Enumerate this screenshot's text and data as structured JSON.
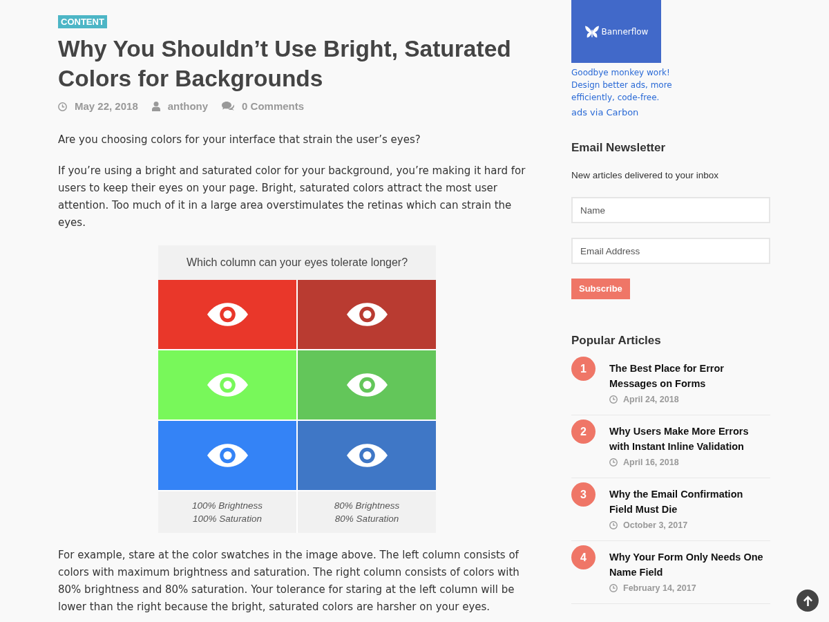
{
  "article": {
    "category": "CONTENT",
    "title": "Why You Shouldn’t Use Bright, Saturated Colors for Backgrounds",
    "meta": [
      {
        "kind": "date",
        "text": "May 22, 2018"
      },
      {
        "kind": "author",
        "text": "anthony"
      },
      {
        "kind": "comments",
        "text": "0 Comments"
      }
    ],
    "body": [
      {
        "kind": "paragraph",
        "text": "Are you choosing colors for your interface that strain the user’s eyes?"
      },
      {
        "kind": "paragraph",
        "text": "If you’re using a bright and saturated color for your background, you’re making it hard for users to keep their eyes on your page. Bright, saturated colors attract the most user attention. Too much of it in a large area overstimulates the retinas which can strain the eyes."
      },
      {
        "kind": "figure",
        "title": "Which column can your eyes tolerate longer?",
        "columns": [
          {
            "swatches": [
              {
                "color": "#e9372a"
              },
              {
                "color": "#78f85a"
              },
              {
                "color": "#3483f6"
              }
            ],
            "caption": [
              "100% Brightness",
              "100% Saturation"
            ]
          },
          {
            "swatches": [
              {
                "color": "#b93b31"
              },
              {
                "color": "#63c65a"
              },
              {
                "color": "#3f77c6"
              }
            ],
            "caption": [
              "80% Brightness",
              "80% Saturation"
            ]
          }
        ]
      },
      {
        "kind": "paragraph",
        "text": "For example, stare at the color swatches in the image above. The left column consists of colors with maximum brightness and saturation. The right column consists of colors with 80% brightness and 80% saturation. Your tolerance for staring at the left column will be lower than the right because the bright, saturated colors are harsher on your eyes."
      }
    ]
  },
  "sidebar": {
    "ad": {
      "brand": "Bannerflow",
      "text": "Goodbye monkey work! Design better ads, more efficiently, code-free.",
      "via": "ads via Carbon"
    },
    "newsletter": {
      "title": "Email Newsletter",
      "description": "New articles delivered to your inbox",
      "fields": [
        {
          "placeholder": "Name"
        },
        {
          "placeholder": "Email Address"
        }
      ],
      "button": "Subscribe"
    },
    "popular": {
      "title": "Popular Articles",
      "items": [
        {
          "number": "1",
          "title": "The Best Place for Error Messages on Forms",
          "date": "April 24, 2018"
        },
        {
          "number": "2",
          "title": "Why Users Make More Errors with Instant Inline Validation",
          "date": "April 16, 2018"
        },
        {
          "number": "3",
          "title": "Why the Email Confirmation Field Must Die",
          "date": "October 3, 2017"
        },
        {
          "number": "4",
          "title": "Why Your Form Only Needs One Name Field",
          "date": "February 14, 2017"
        }
      ]
    }
  }
}
